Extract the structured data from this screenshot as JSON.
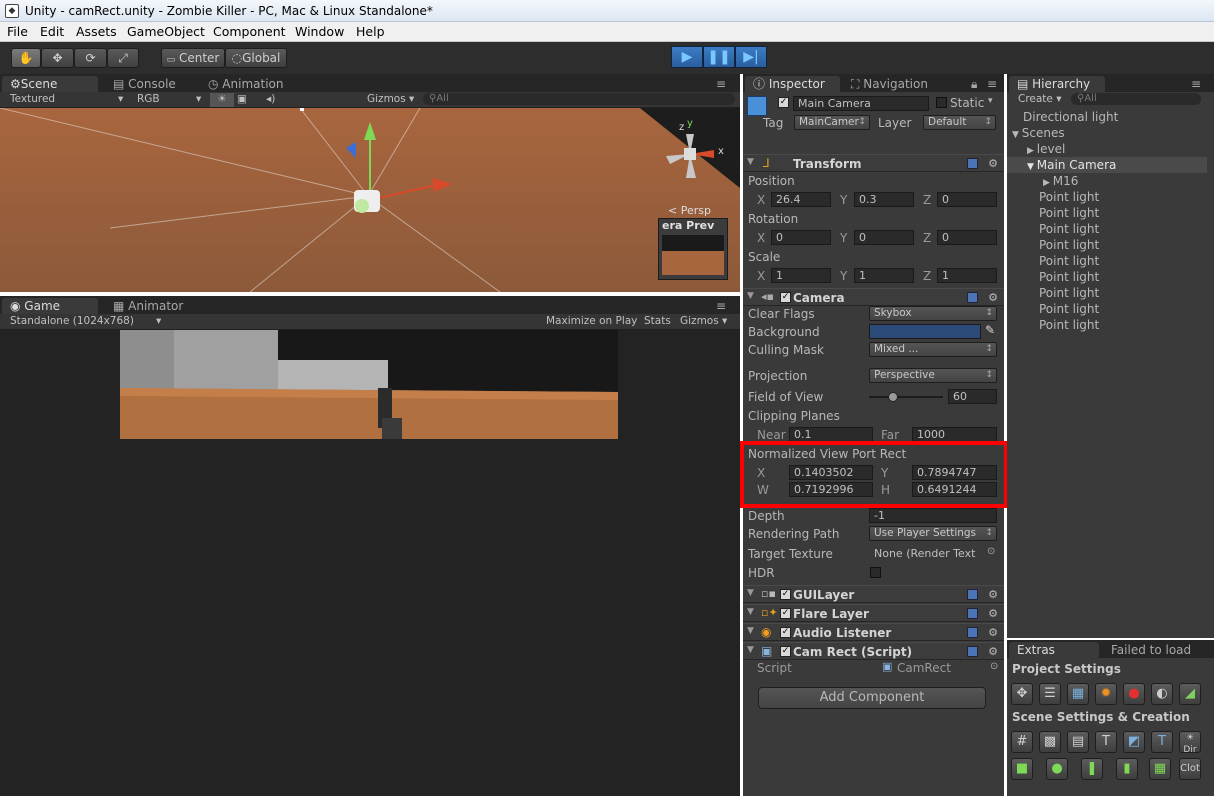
{
  "titlebar": {
    "title": "Unity - camRect.unity - Zombie Killer - PC, Mac & Linux Standalone*",
    "icon": "unity-logo-icon"
  },
  "menu": [
    "File",
    "Edit",
    "Assets",
    "GameObject",
    "Component",
    "Window",
    "Help"
  ],
  "toolbar": {
    "pivot_label": "Center",
    "space_label": "Global"
  },
  "scene_tabs": {
    "scene": "Scene",
    "console": "Console",
    "animation": "Animation"
  },
  "scene_bar": {
    "render_mode": "Textured",
    "color_mode": "RGB",
    "gizmos": "Gizmos",
    "search_placeholder": "All"
  },
  "scene_view": {
    "persp_label": "Persp",
    "preview_label": "era Prev",
    "axis_y": "y",
    "axis_z": "z",
    "axis_x": "x"
  },
  "game_tabs": {
    "game": "Game",
    "animator": "Animator"
  },
  "game_bar": {
    "resolution": "Standalone (1024x768)",
    "maximize": "Maximize on Play",
    "stats": "Stats",
    "gizmos": "Gizmos"
  },
  "inspector": {
    "tab": "Inspector",
    "nav_tab": "Navigation",
    "object_name": "Main Camera",
    "static_label": "Static",
    "tag_label": "Tag",
    "tag_value": "MainCamer",
    "layer_label": "Layer",
    "layer_value": "Default",
    "transform": {
      "title": "Transform",
      "position_label": "Position",
      "position": {
        "x": "26.4",
        "y": "0.3",
        "z": "0"
      },
      "rotation_label": "Rotation",
      "rotation": {
        "x": "0",
        "y": "0",
        "z": "0"
      },
      "scale_label": "Scale",
      "scale": {
        "x": "1",
        "y": "1",
        "z": "1"
      }
    },
    "camera": {
      "title": "Camera",
      "clear_flags_label": "Clear Flags",
      "clear_flags": "Skybox",
      "background_label": "Background",
      "background_color": "#2c4a78",
      "culling_mask_label": "Culling Mask",
      "culling_mask": "Mixed ...",
      "projection_label": "Projection",
      "projection": "Perspective",
      "fov_label": "Field of View",
      "fov": "60",
      "fov_slider_fraction": 0.33,
      "clipping_label": "Clipping Planes",
      "near_label": "Near",
      "near": "0.1",
      "far_label": "Far",
      "far": "1000",
      "viewport_label": "Normalized View Port Rect",
      "viewport": {
        "x": "0.1403502",
        "y": "0.7894747",
        "w": "0.7192996",
        "h": "0.6491244"
      },
      "depth_label": "Depth",
      "depth": "-1",
      "rendering_path_label": "Rendering Path",
      "rendering_path": "Use Player Settings",
      "target_texture_label": "Target Texture",
      "target_texture": "None (Render Text",
      "hdr_label": "HDR"
    },
    "components": [
      "GUILayer",
      "Flare Layer",
      "Audio Listener",
      "Cam Rect (Script)"
    ],
    "script_label": "Script",
    "script_value": "CamRect",
    "add_component": "Add Component",
    "highlight_color": "#ff0000"
  },
  "hierarchy": {
    "tab": "Hierarchy",
    "create": "Create",
    "search_placeholder": "All",
    "items": [
      "Directional light",
      "Scenes",
      "level",
      "Main Camera",
      "M16",
      "Point light",
      "Point light",
      "Point light",
      "Point light",
      "Point light",
      "Point light",
      "Point light",
      "Point light",
      "Point light"
    ]
  },
  "extras": {
    "tab": "Extras",
    "failed": "Failed to load",
    "project_settings": "Project Settings",
    "scene_settings": "Scene Settings & Creation",
    "dir_label": "Dir",
    "cloth_label": "Clot"
  }
}
